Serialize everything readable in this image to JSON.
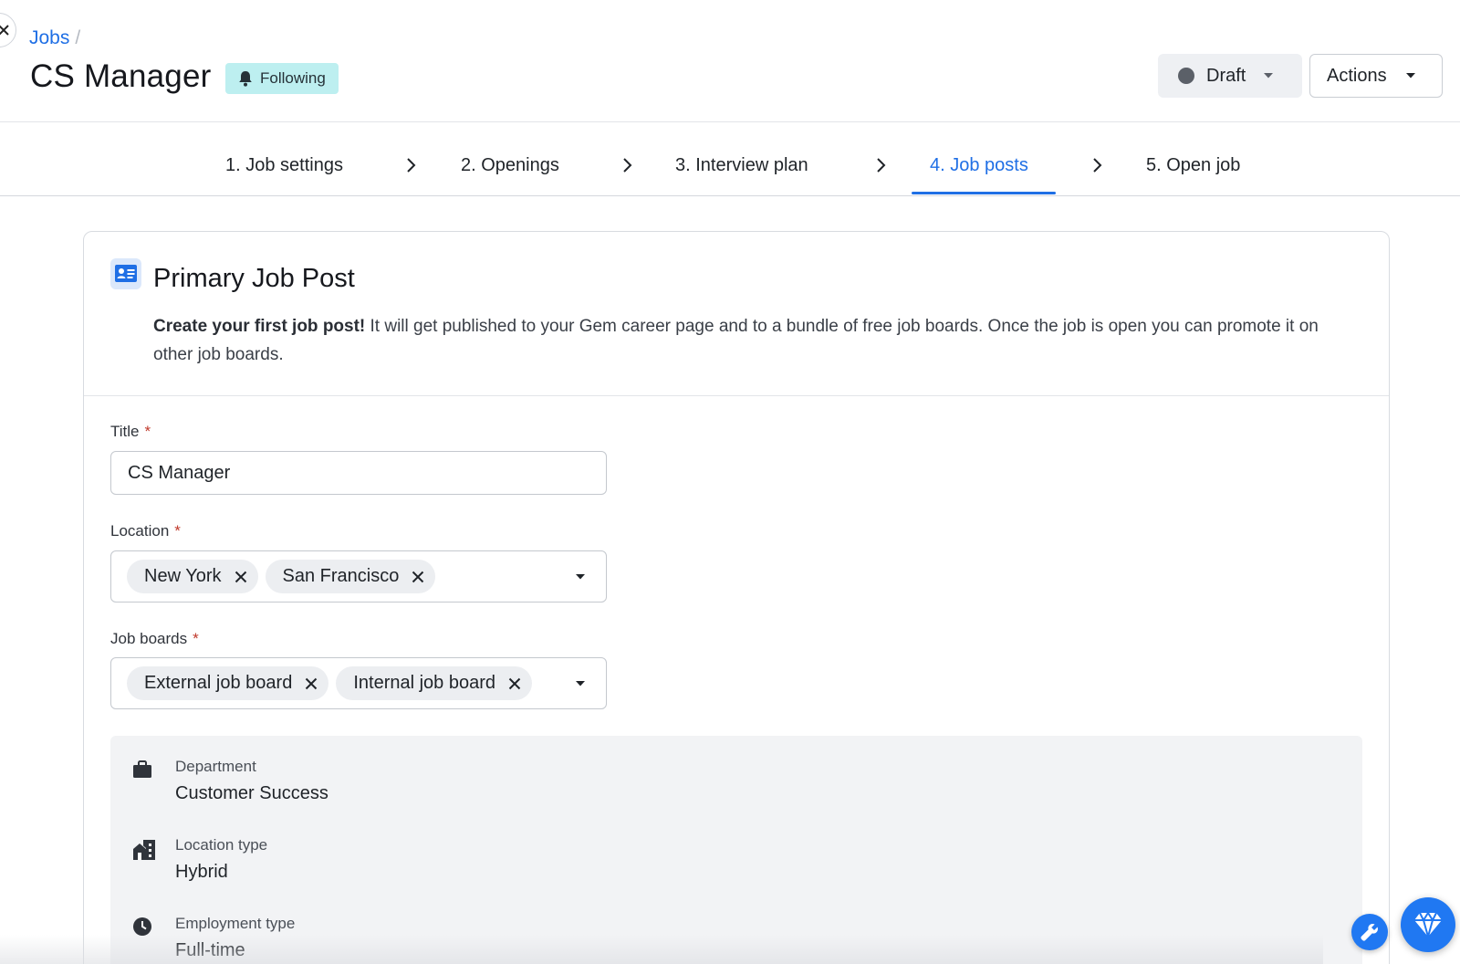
{
  "header": {
    "breadcrumb": "Jobs",
    "breadcrumb_sep": "/",
    "title": "CS Manager",
    "follow_label": "Following",
    "status_label": "Draft",
    "actions_label": "Actions"
  },
  "steps": [
    {
      "label": "1. Job settings",
      "active": false
    },
    {
      "label": "2. Openings",
      "active": false
    },
    {
      "label": "3. Interview plan",
      "active": false
    },
    {
      "label": "4. Job posts",
      "active": true
    },
    {
      "label": "5. Open job",
      "active": false
    }
  ],
  "card": {
    "title": "Primary Job Post",
    "desc_bold": "Create your first job post!",
    "desc_rest": " It will get published to your Gem career page and to a bundle of free job boards. Once the job is open you can promote it on other job boards."
  },
  "form": {
    "title_label": "Title",
    "title_value": "CS Manager",
    "location_label": "Location",
    "locations": [
      "New York",
      "San Francisco"
    ],
    "job_boards_label": "Job boards",
    "job_boards": [
      "External job board",
      "Internal job board"
    ],
    "required_mark": "*"
  },
  "info": [
    {
      "label": "Department",
      "value": "Customer Success",
      "icon": "briefcase-icon"
    },
    {
      "label": "Location type",
      "value": "Hybrid",
      "icon": "building-icon"
    },
    {
      "label": "Employment type",
      "value": "Full-time",
      "icon": "clock-icon"
    }
  ],
  "colors": {
    "accent": "#1f6fe5",
    "badge_bg": "#bdeff0",
    "fab": "#2078f2"
  }
}
